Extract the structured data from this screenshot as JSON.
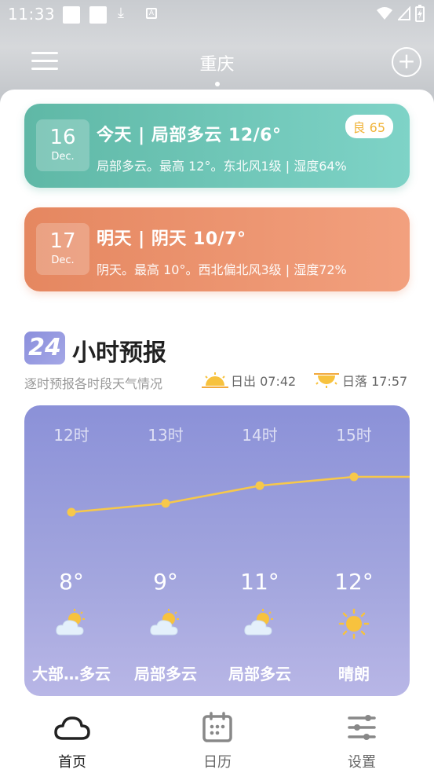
{
  "status_bar": {
    "time": "11:33",
    "icons": [
      "app-icon",
      "app-icon",
      "download-icon",
      "a-icon",
      "wifi-icon",
      "signal-icon",
      "battery-charging-icon"
    ]
  },
  "header": {
    "city": "重庆",
    "menu_icon": "menu-icon",
    "add_icon": "add-circle-icon"
  },
  "days": [
    {
      "date_day": "16",
      "date_month": "Dec.",
      "title": "今天 | 局部多云  12/6°",
      "desc": "局部多云。最高 12°。东北风1级 | 湿度64%",
      "aqi": "良 65"
    },
    {
      "date_day": "17",
      "date_month": "Dec.",
      "title": "明天 | 阴天  10/7°",
      "desc": "阴天。最高 10°。西北偏北风3级 | 湿度72%"
    }
  ],
  "forecast": {
    "badge": "24",
    "title": "小时预报",
    "subtitle": "逐时预报各时段天气情况",
    "sunrise": "日出 07:42",
    "sunset": "日落 17:57",
    "hours": [
      {
        "time": "12时",
        "temp": "8°",
        "temp_value": 8,
        "cond": "大部…多云",
        "icon": "partly-cloudy-icon"
      },
      {
        "time": "13时",
        "temp": "9°",
        "temp_value": 9,
        "cond": "局部多云",
        "icon": "partly-cloudy-icon"
      },
      {
        "time": "14时",
        "temp": "11°",
        "temp_value": 11,
        "cond": "局部多云",
        "icon": "partly-cloudy-icon"
      },
      {
        "time": "15时",
        "temp": "12°",
        "temp_value": 12,
        "cond": "晴朗",
        "icon": "sunny-icon"
      }
    ]
  },
  "nav": {
    "items": [
      {
        "label": "首页",
        "icon": "cloud-icon",
        "active": true
      },
      {
        "label": "日历",
        "icon": "calendar-icon",
        "active": false
      },
      {
        "label": "设置",
        "icon": "settings-sliders-icon",
        "active": false
      }
    ]
  },
  "colors": {
    "today_card": "#6cc4b6",
    "tomorrow_card": "#ec9470",
    "hourly_bg": "#9699db",
    "line": "#f7c84a",
    "aqi_text": "#f0b43a"
  }
}
